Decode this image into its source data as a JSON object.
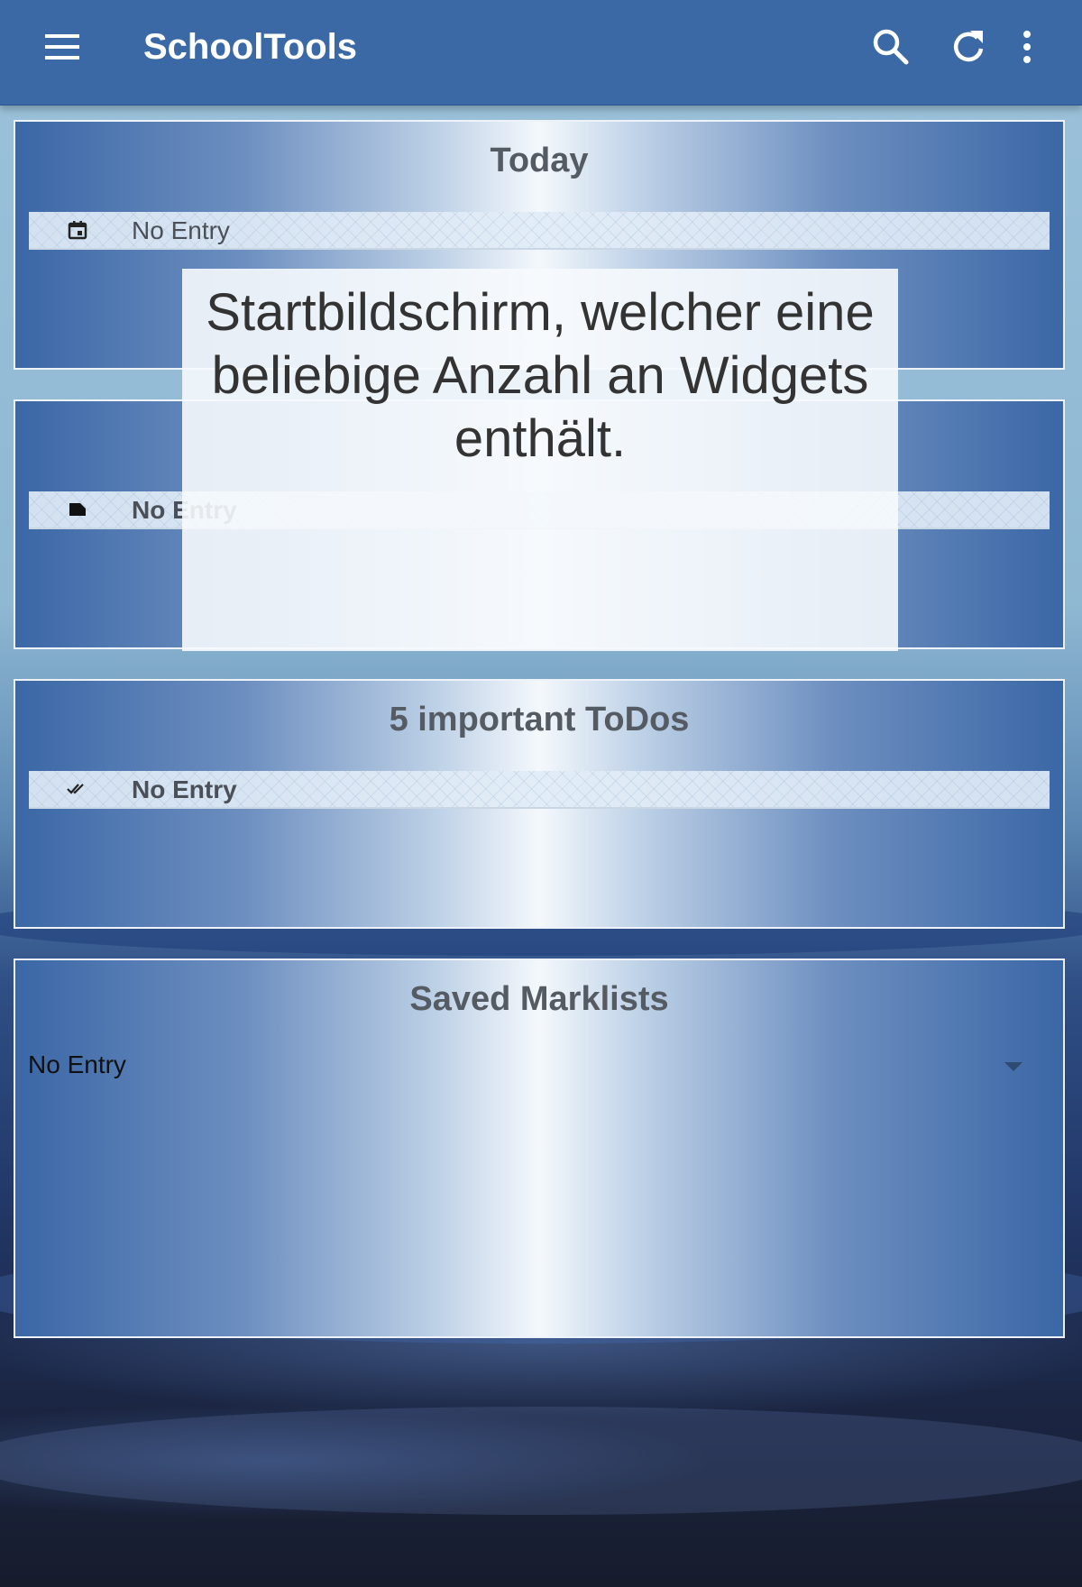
{
  "appbar": {
    "title": "SchoolTools",
    "icons": [
      "menu-icon",
      "search-icon",
      "refresh-icon",
      "more-vert-icon"
    ]
  },
  "widgets": {
    "today": {
      "title": "Today",
      "entry": "No Entry",
      "icon": "calendar-icon"
    },
    "next": {
      "entry": "No Entry",
      "icon": "label-icon"
    },
    "todos": {
      "title": "5 important ToDos",
      "entry": "No Entry",
      "icon": "double-check-icon"
    },
    "marklists": {
      "title": "Saved Marklists",
      "selected": "No Entry",
      "icon": "dropdown-arrow-icon"
    }
  },
  "overlay": {
    "caption": "Startbildschirm, welcher eine beliebige Anzahl an Widgets enthält."
  },
  "colors": {
    "appbar": "#3a69a6",
    "widget_title": "#555b63",
    "border": "#eef3fa"
  }
}
